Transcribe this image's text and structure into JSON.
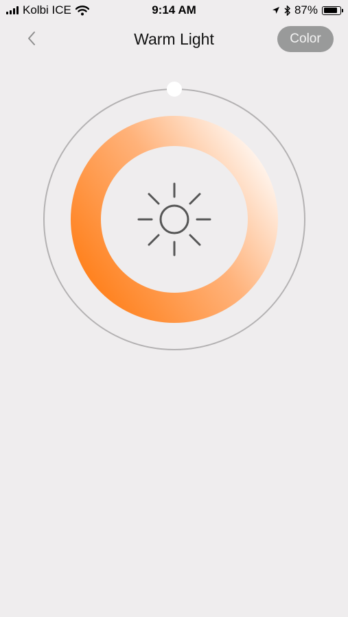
{
  "status_bar": {
    "carrier": "Kolbi ICE",
    "time": "9:14 AM",
    "battery_percent": "87%",
    "battery_level": 0.87,
    "icons": [
      "signal-icon",
      "wifi-icon",
      "location-icon",
      "bluetooth-icon",
      "battery-icon"
    ]
  },
  "nav": {
    "title": "Warm Light",
    "color_button_label": "Color",
    "back_icon": "chevron-left-icon"
  },
  "dial": {
    "center_icon": "sun-icon",
    "slider_value": 0,
    "colors": {
      "warm": "#ff7a10",
      "mid": "#ffb27a",
      "cool": "#ffffff",
      "track": "#b3b1b2",
      "knob": "#ffffff"
    }
  }
}
